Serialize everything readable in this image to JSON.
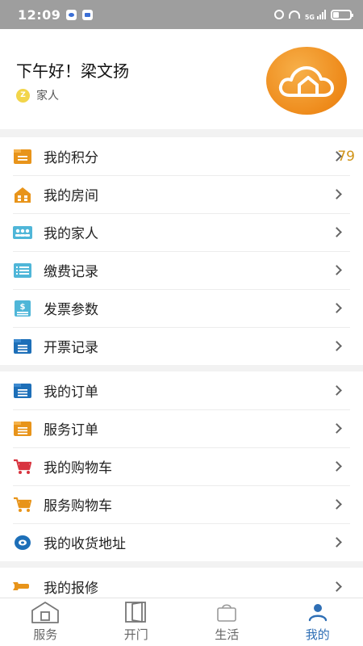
{
  "status_bar": {
    "time": "12:09",
    "network": "5G"
  },
  "header": {
    "greeting": "下午好！梁文扬",
    "role_badge": "Z",
    "role": "家人"
  },
  "menu_groups": [
    {
      "items": [
        {
          "label": "我的积分",
          "value": "79",
          "icon": "points-icon",
          "color": "#e8941a"
        },
        {
          "label": "我的房间",
          "icon": "house-icon",
          "color": "#e8941a"
        },
        {
          "label": "我的家人",
          "icon": "family-icon",
          "color": "#4fb6d8"
        },
        {
          "label": "缴费记录",
          "icon": "list-icon",
          "color": "#4fb6d8"
        },
        {
          "label": "发票参数",
          "icon": "invoice-icon",
          "color": "#4fb6d8"
        },
        {
          "label": "开票记录",
          "icon": "document-icon",
          "color": "#1d6fb8"
        }
      ]
    },
    {
      "items": [
        {
          "label": "我的订单",
          "icon": "order-icon",
          "color": "#1d6fb8"
        },
        {
          "label": "服务订单",
          "icon": "service-order-icon",
          "color": "#e8941a"
        },
        {
          "label": "我的购物车",
          "icon": "cart-icon",
          "color": "#d8343f"
        },
        {
          "label": "服务购物车",
          "icon": "cart-icon",
          "color": "#e8941a"
        },
        {
          "label": "我的收货地址",
          "icon": "location-icon",
          "color": "#1d6fb8"
        }
      ]
    },
    {
      "items": [
        {
          "label": "我的报修",
          "icon": "wrench-icon",
          "color": "#e8941a"
        }
      ]
    }
  ],
  "tabbar": [
    {
      "label": "服务",
      "icon": "home-icon"
    },
    {
      "label": "开门",
      "icon": "door-icon"
    },
    {
      "label": "生活",
      "icon": "bag-icon"
    },
    {
      "label": "我的",
      "icon": "person-icon",
      "active": true
    }
  ]
}
